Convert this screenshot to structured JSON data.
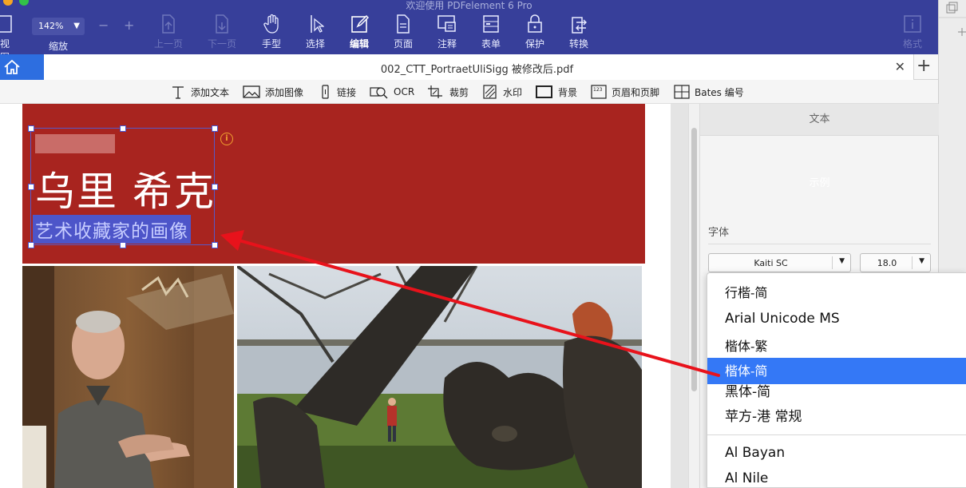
{
  "window": {
    "title": "欢迎使用 PDFelement 6 Pro"
  },
  "toolbar": {
    "left_view_label": "视图",
    "zoom_value": "142%",
    "zoom_label": "缩放",
    "items": [
      {
        "label": "上一页",
        "icon": "page-up-icon",
        "enabled": false
      },
      {
        "label": "下一页",
        "icon": "page-down-icon",
        "enabled": false
      },
      {
        "label": "手型",
        "icon": "hand-icon",
        "enabled": true
      },
      {
        "label": "选择",
        "icon": "cursor-icon",
        "enabled": true
      },
      {
        "label": "编辑",
        "icon": "edit-icon",
        "enabled": true,
        "active": true
      },
      {
        "label": "页面",
        "icon": "page-icon",
        "enabled": true
      },
      {
        "label": "注释",
        "icon": "comment-icon",
        "enabled": true
      },
      {
        "label": "表单",
        "icon": "form-icon",
        "enabled": true
      },
      {
        "label": "保护",
        "icon": "lock-icon",
        "enabled": true
      },
      {
        "label": "转换",
        "icon": "convert-icon",
        "enabled": true
      }
    ],
    "format_label": "格式"
  },
  "tab": {
    "title": "002_CTT_PortraetUliSigg 被修改后.pdf"
  },
  "edit_toolbar": [
    {
      "label": "添加文本",
      "icon": "text-icon"
    },
    {
      "label": "添加图像",
      "icon": "image-icon"
    },
    {
      "label": "链接",
      "icon": "link-icon"
    },
    {
      "label": "OCR",
      "icon": "ocr-icon"
    },
    {
      "label": "裁剪",
      "icon": "crop-icon"
    },
    {
      "label": "水印",
      "icon": "watermark-icon"
    },
    {
      "label": "背景",
      "icon": "background-icon"
    },
    {
      "label": "页眉和页脚",
      "icon": "header-footer-icon"
    },
    {
      "label": "Bates 编号",
      "icon": "bates-icon"
    }
  ],
  "document": {
    "heading": "乌里 希克",
    "subheading": "艺术收藏家的画像"
  },
  "panel": {
    "header": "文本",
    "sample": "示例",
    "font_section": "字体",
    "font_value": "Kaiti SC",
    "size_value": "18.0"
  },
  "font_dropdown": {
    "options": [
      {
        "label": "行楷-简",
        "selected": false
      },
      {
        "label": "Arial Unicode MS",
        "selected": false
      },
      {
        "label": "楷体-繁",
        "selected": false
      },
      {
        "label": "楷体-简",
        "selected": true
      },
      {
        "label": "黑体-简",
        "selected": false
      },
      {
        "label": "苹方-港 常规",
        "selected": false
      },
      {
        "label": "Al Bayan",
        "selected": false
      },
      {
        "label": "Al Nile",
        "selected": false
      }
    ]
  },
  "colors": {
    "toolbar_bg": "#373f9a",
    "banner": "#a8241f",
    "selection": "#3478f6",
    "annotation_arrow": "#e8121b"
  }
}
